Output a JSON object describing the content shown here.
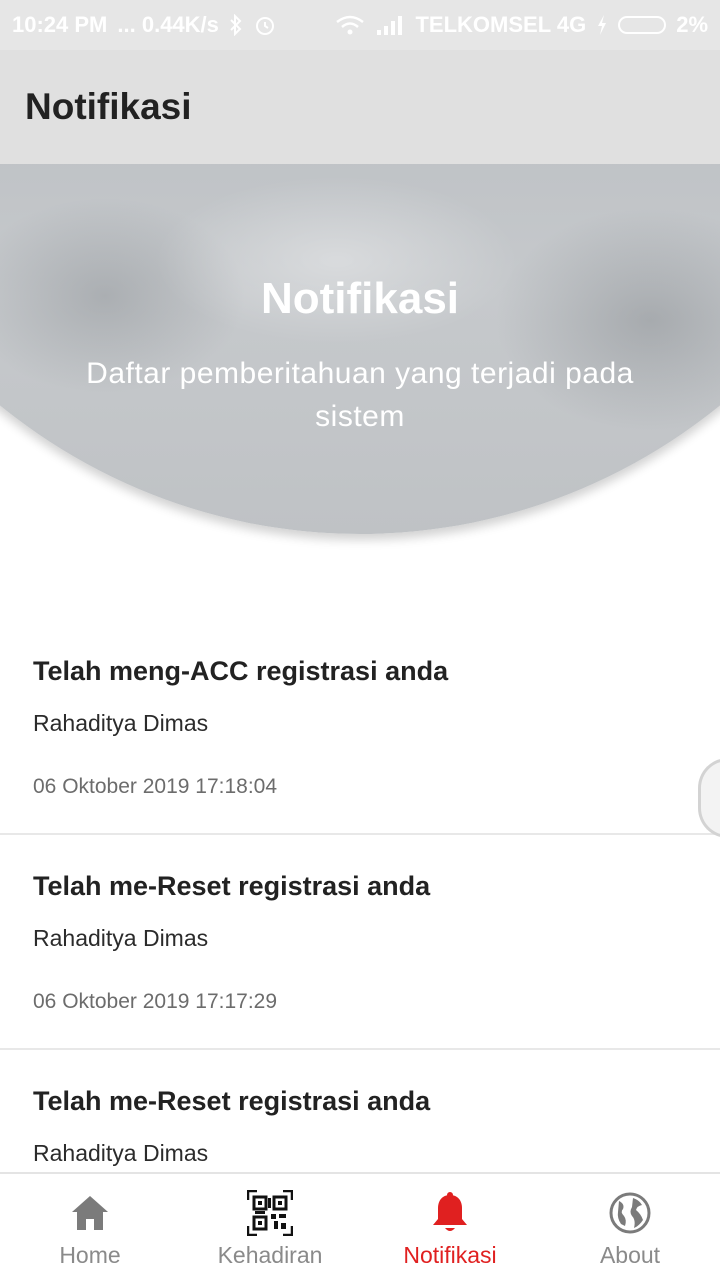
{
  "status_bar": {
    "time": "10:24 PM",
    "speed": "... 0.44K/s",
    "carrier": "TELKOMSEL 4G",
    "battery": "2%",
    "icons": [
      "bluetooth-icon",
      "alarm-icon",
      "wifi-icon",
      "signal-icon",
      "charging-icon",
      "battery-icon"
    ]
  },
  "app_bar": {
    "title": "Notifikasi"
  },
  "hero": {
    "title": "Notifikasi",
    "subtitle": "Daftar pemberitahuan yang terjadi pada sistem"
  },
  "notifications": [
    {
      "title": "Telah meng-ACC registrasi anda",
      "user": "Rahaditya Dimas",
      "time": "06 Oktober 2019 17:18:04"
    },
    {
      "title": "Telah me-Reset registrasi anda",
      "user": "Rahaditya Dimas",
      "time": "06 Oktober 2019 17:17:29"
    },
    {
      "title": "Telah me-Reset registrasi anda",
      "user": "Rahaditya Dimas",
      "time": ""
    }
  ],
  "bottom_nav": {
    "items": [
      {
        "label": "Home",
        "icon": "home-icon",
        "active": false
      },
      {
        "label": "Kehadiran",
        "icon": "qr-code-icon",
        "active": false
      },
      {
        "label": "Notifikasi",
        "icon": "bell-icon",
        "active": true
      },
      {
        "label": "About",
        "icon": "globe-icon",
        "active": false
      }
    ]
  },
  "colors": {
    "accent_active": "#e02020",
    "nav_inactive": "#8a8a8a",
    "app_bar_bg": "#e0e0e0"
  }
}
